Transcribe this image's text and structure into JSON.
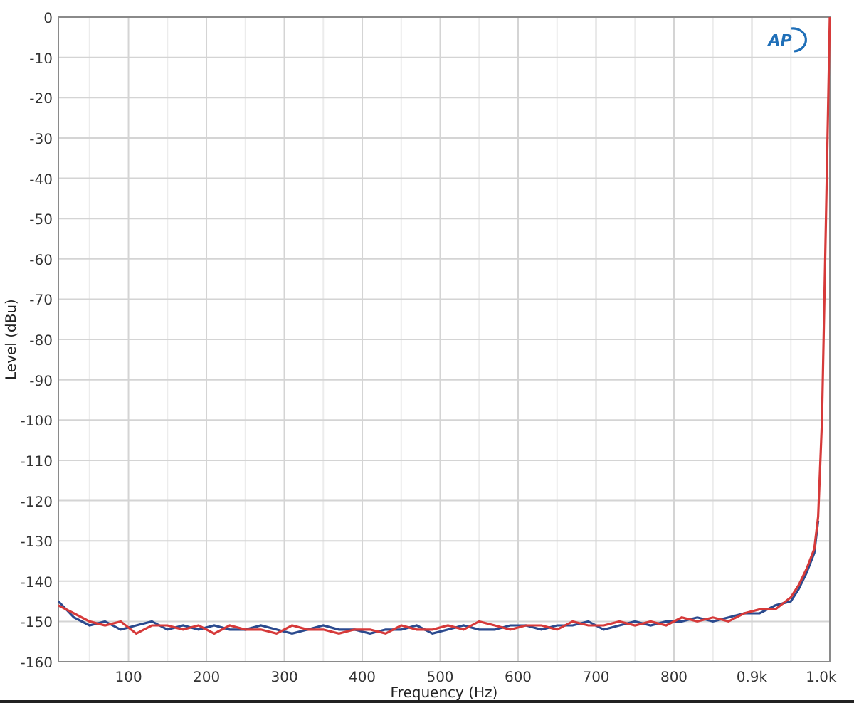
{
  "logo": {
    "text": "AP"
  },
  "chart_data": {
    "type": "line",
    "grid": true,
    "xlabel": "Frequency (Hz)",
    "ylabel": "Level (dBu)",
    "xlim": [
      10,
      1000
    ],
    "ylim": [
      -160,
      0
    ],
    "xticks": [
      100,
      200,
      300,
      400,
      500,
      600,
      700,
      800,
      {
        "value": 900,
        "label": "0.9k"
      },
      {
        "value": 1000,
        "label": "1.0k"
      }
    ],
    "yticks": [
      0,
      -10,
      -20,
      -30,
      -40,
      -50,
      -60,
      -70,
      -80,
      -90,
      -100,
      -110,
      -120,
      -130,
      -140,
      -150,
      -160
    ],
    "x": [
      10,
      30,
      50,
      70,
      90,
      110,
      130,
      150,
      170,
      190,
      210,
      230,
      250,
      270,
      290,
      310,
      330,
      350,
      370,
      390,
      410,
      430,
      450,
      470,
      490,
      510,
      530,
      550,
      570,
      590,
      610,
      630,
      650,
      670,
      690,
      710,
      730,
      750,
      770,
      790,
      810,
      830,
      850,
      870,
      890,
      910,
      930,
      950,
      960,
      970,
      980,
      985,
      990,
      995,
      1000
    ],
    "series": [
      {
        "color": "#2b4a8e",
        "values": [
          -145,
          -149,
          -151,
          -150,
          -152,
          -151,
          -150,
          -152,
          -151,
          -152,
          -151,
          -152,
          -152,
          -151,
          -152,
          -153,
          -152,
          -151,
          -152,
          -152,
          -153,
          -152,
          -152,
          -151,
          -153,
          -152,
          -151,
          -152,
          -152,
          -151,
          -151,
          -152,
          -151,
          -151,
          -150,
          -152,
          -151,
          -150,
          -151,
          -150,
          -150,
          -149,
          -150,
          -149,
          -148,
          -148,
          -146,
          -145,
          -142,
          -138,
          -133,
          -125,
          null,
          null,
          null
        ]
      },
      {
        "color": "#d63a3a",
        "values": [
          -146,
          -148,
          -150,
          -151,
          -150,
          -153,
          -151,
          -151,
          -152,
          -151,
          -153,
          -151,
          -152,
          -152,
          -153,
          -151,
          -152,
          -152,
          -153,
          -152,
          -152,
          -153,
          -151,
          -152,
          -152,
          -151,
          -152,
          -150,
          -151,
          -152,
          -151,
          -151,
          -152,
          -150,
          -151,
          -151,
          -150,
          -151,
          -150,
          -151,
          -149,
          -150,
          -149,
          -150,
          -148,
          -147,
          -147,
          -144,
          -141,
          -137,
          -132,
          -124,
          -100,
          -50,
          0
        ]
      }
    ]
  }
}
